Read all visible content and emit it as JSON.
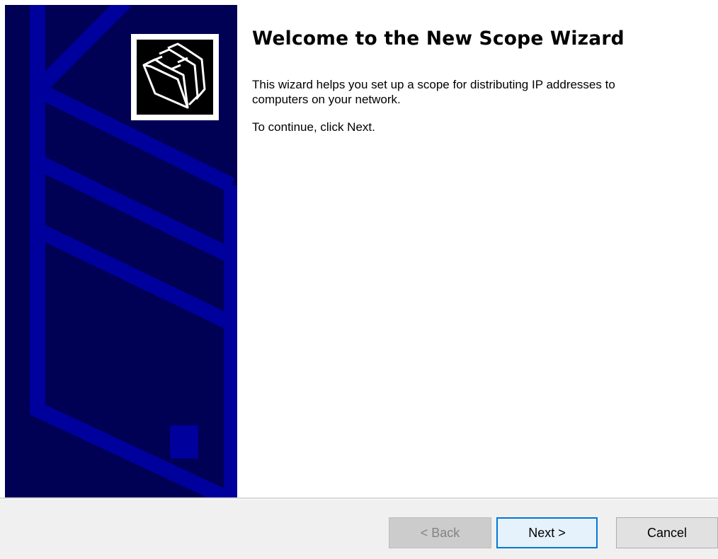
{
  "wizard": {
    "title": "Welcome to the New Scope Wizard",
    "description": "This wizard helps you set up a scope for distributing IP addresses to computers on your network.",
    "instruction": "To continue, click Next."
  },
  "buttons": {
    "back_label": "< Back",
    "next_label": "Next >",
    "cancel_label": "Cancel",
    "back_enabled": false
  },
  "banner": {
    "icon": "folders-icon",
    "background_color": "#000054",
    "line_color": "#00009c"
  }
}
